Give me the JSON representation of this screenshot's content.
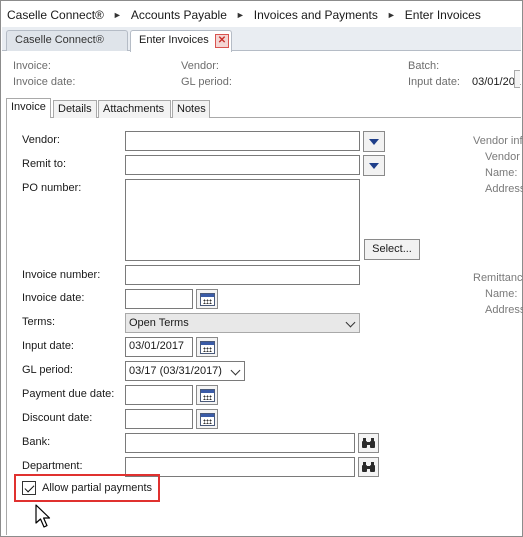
{
  "breadcrumb": {
    "items": [
      "Caselle Connect®",
      "Accounts Payable",
      "Invoices and Payments",
      "Enter Invoices"
    ]
  },
  "doc_tabs": [
    {
      "label": "Caselle Connect®"
    },
    {
      "label": "Enter Invoices",
      "close_icon": "close-icon"
    }
  ],
  "summary": {
    "invoice_label": "Invoice:",
    "invoice_date_label": "Invoice date:",
    "vendor_label": "Vendor:",
    "gl_period_label": "GL period:",
    "batch_label": "Batch:",
    "input_date_label": "Input date:",
    "input_date_value": "03/01/201"
  },
  "form_tabs": [
    "Invoice",
    "Details",
    "Attachments",
    "Notes"
  ],
  "form": {
    "vendor_label": "Vendor:",
    "remit_to_label": "Remit to:",
    "po_number_label": "PO number:",
    "select_button": "Select...",
    "invoice_number_label": "Invoice number:",
    "invoice_date_label": "Invoice date:",
    "terms_label": "Terms:",
    "terms_value": "Open Terms",
    "input_date_label": "Input date:",
    "input_date_value": "03/01/2017",
    "gl_period_label": "GL period:",
    "gl_period_value": "03/17 (03/31/2017)",
    "payment_due_date_label": "Payment due date:",
    "discount_date_label": "Discount date:",
    "bank_label": "Bank:",
    "department_label": "Department:",
    "allow_partial_label": "Allow partial payments",
    "allow_partial_checked": true
  },
  "side_panel": {
    "vendor_info_title": "Vendor inf",
    "vendor_line": "Vendor",
    "name_line": "Name:",
    "address_line": "Address",
    "remittance_title": "Remittanc",
    "remit_name_line": "Name:",
    "remit_address_line": "Address"
  },
  "colors": {
    "highlight": "#e0312f",
    "dropdown_arrow": "#1f3f8a"
  }
}
